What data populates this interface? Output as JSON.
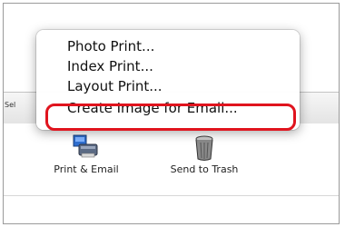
{
  "toolbar": {
    "select_text": "Sel"
  },
  "menu": {
    "items": [
      {
        "label": "Photo Print..."
      },
      {
        "label": "Index Print..."
      },
      {
        "label": "Layout Print..."
      },
      {
        "label": "Create Image for Email..."
      }
    ],
    "highlight_color": "#e0141e"
  },
  "tools": {
    "print_email_label": "Print & Email",
    "trash_label": "Send to Trash"
  }
}
